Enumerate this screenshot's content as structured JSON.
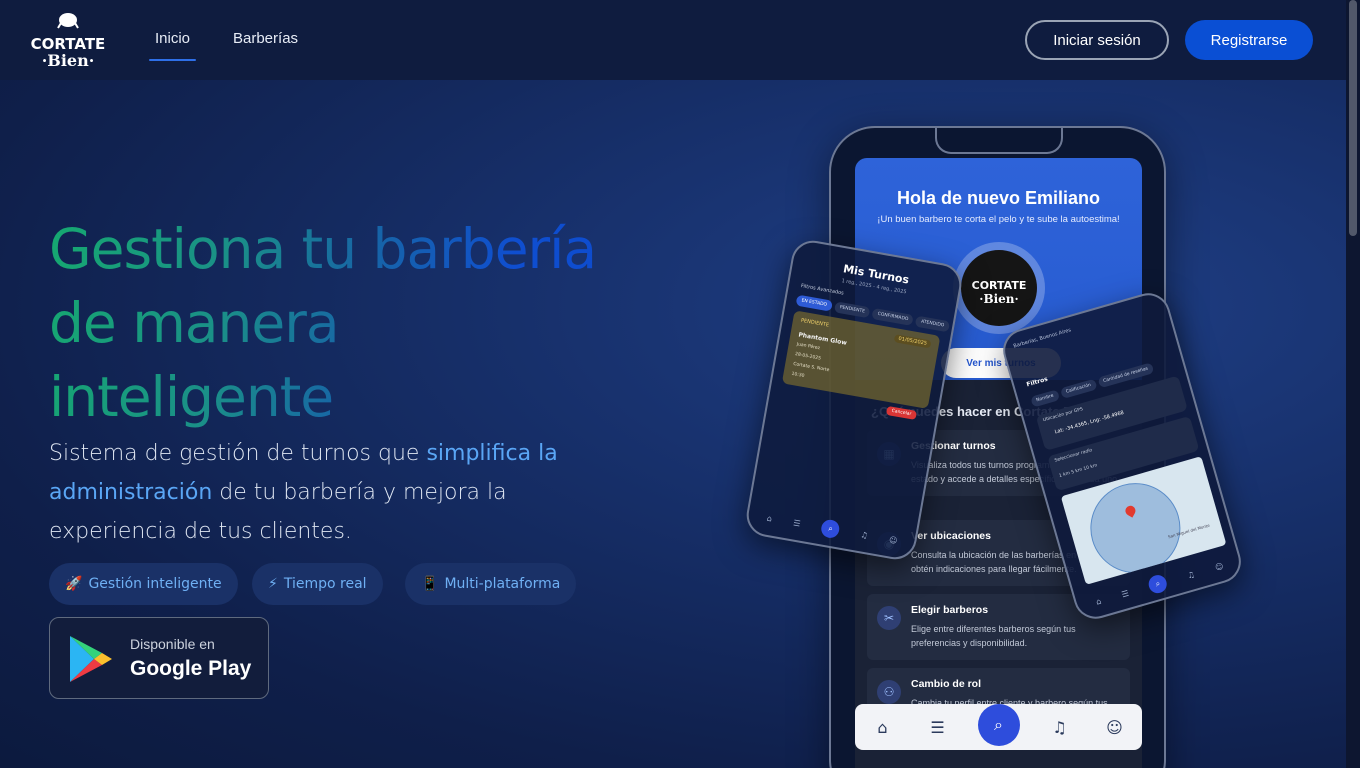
{
  "header": {
    "logo_top": "CORTATE",
    "logo_bottom": "·Bien·",
    "nav": [
      {
        "label": "Inicio",
        "active": true
      },
      {
        "label": "Barberías",
        "active": false
      }
    ],
    "login_label": "Iniciar sesión",
    "register_label": "Registrarse"
  },
  "hero": {
    "title_line1": "Gestiona tu barbería",
    "title_line2": "de manera",
    "title_line3": "inteligente",
    "subtitle_part1": "Sistema de gestión de turnos que ",
    "subtitle_highlight": "simplifica la administración",
    "subtitle_part2": " de tu barbería y mejora la experiencia de tus clientes.",
    "chips": [
      {
        "icon": "🚀",
        "label": "Gestión inteligente"
      },
      {
        "icon": "⚡",
        "label": "Tiempo real"
      },
      {
        "icon": "📱",
        "label": "Multi-plataforma"
      }
    ],
    "store": {
      "available": "Disponible en",
      "name": "Google Play"
    }
  },
  "phone_main": {
    "greeting": "Hola de nuevo Emiliano",
    "tagline": "¡Un buen barbero te corta el pelo y te sube la autoestima!",
    "logo_top": "CORTATE",
    "logo_bottom": "·Bien·",
    "cta": "Ver mis turnos",
    "section_title": "¿Qué puedes hacer en Cortate Bien?",
    "features": [
      {
        "icon": "calendar-icon",
        "title": "Gestionar turnos",
        "desc": "Visualiza todos tus turnos programados, filtra por estado y accede a detalles específicos de cada uno."
      },
      {
        "icon": "location-icon",
        "title": "Ver ubicaciones",
        "desc": "Consulta la ubicación de las barberías en el mapa y obtén indicaciones para llegar fácilmente."
      },
      {
        "icon": "scissors-icon",
        "title": "Elegir barberos",
        "desc": "Elige entre diferentes barberos según tus preferencias y disponibilidad."
      },
      {
        "icon": "user-switch-icon",
        "title": "Cambio de rol",
        "desc": "Cambia tu perfil entre cliente y barbero según tus necesidades en cualquier momento."
      }
    ]
  },
  "phone_left": {
    "title": "Mis Turnos",
    "subtitle": "1 reg., 2025 - 4 reg., 2025",
    "filters": "Filtros Avanzados",
    "tabs": [
      "EN ESTADO",
      "PENDIENTE",
      "CONFIRMADO",
      "ATENDIDO"
    ],
    "card_status": "PENDIENTE",
    "card_date": "01/05/2025",
    "card_name": "Phantom Glow",
    "card_lines": [
      "Juan Pérez",
      "28-05-2025",
      "Cortate S. Norte",
      "10:30"
    ],
    "cancel": "Cancelar"
  },
  "phone_right": {
    "header": "Barberías, Buenos Aires",
    "filters": "Filtros",
    "tabs": [
      "Nombre",
      "Calificación",
      "Cantidad de reseñas"
    ],
    "location_label": "Ubicación por GPS",
    "location_value": "Lat: -34.4365, Lng: -58.4968",
    "radius_label": "Seleccionar radio",
    "radius_options": "1 km   5 km   10 km",
    "map_town": "San Miguel del Monte"
  }
}
